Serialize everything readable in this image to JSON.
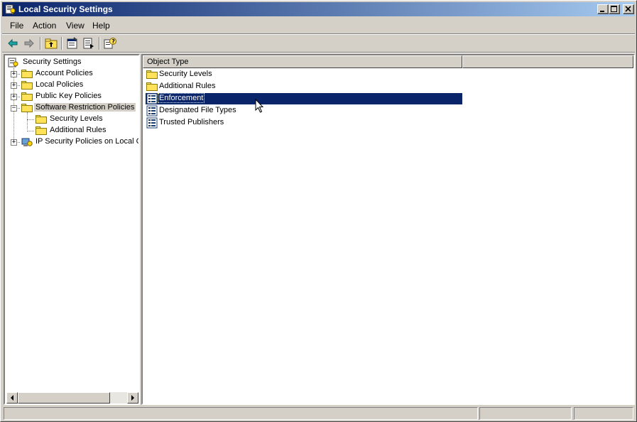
{
  "window": {
    "title": "Local Security Settings",
    "icon": "security-settings-icon",
    "controls": [
      "minimize",
      "maximize",
      "close"
    ]
  },
  "menu": [
    "File",
    "Action",
    "View",
    "Help"
  ],
  "toolbar": {
    "buttons": [
      "back-arrow-icon",
      "forward-arrow-icon",
      "up-folder-icon",
      "properties-icon",
      "export-list-icon",
      "help-icon"
    ]
  },
  "tree": {
    "root": "Security Settings",
    "items": [
      {
        "label": "Account Policies",
        "expander": "+"
      },
      {
        "label": "Local Policies",
        "expander": "+"
      },
      {
        "label": "Public Key Policies",
        "expander": "+"
      },
      {
        "label": "Software Restriction Policies",
        "expander": "−",
        "selected": true
      },
      {
        "label": "Security Levels"
      },
      {
        "label": "Additional Rules"
      },
      {
        "label": "IP Security Policies on Local Co",
        "expander": "+"
      }
    ]
  },
  "list": {
    "columns": [
      "Object Type",
      ""
    ],
    "rows": [
      {
        "label": "Security Levels",
        "icon": "folder-icon"
      },
      {
        "label": "Additional Rules",
        "icon": "folder-icon"
      },
      {
        "label": "Enforcement",
        "icon": "policy-object-icon",
        "selected": true
      },
      {
        "label": "Designated File Types",
        "icon": "policy-object-icon"
      },
      {
        "label": "Trusted Publishers",
        "icon": "policy-object-icon"
      }
    ]
  },
  "colors": {
    "titlebar_start": "#0a246a",
    "titlebar_end": "#a6caf0",
    "selection": "#0a246a",
    "face": "#d4d0c8"
  }
}
